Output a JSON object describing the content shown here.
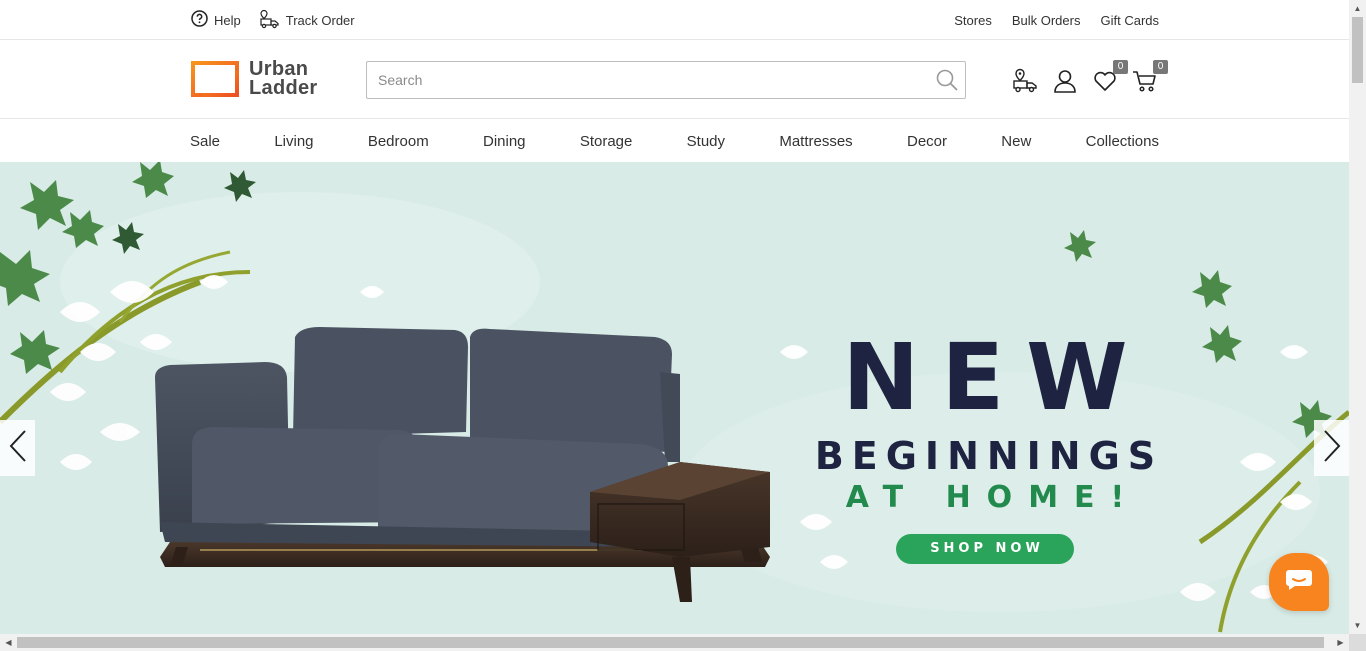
{
  "topbar": {
    "help_label": "Help",
    "track_order_label": "Track Order",
    "stores_label": "Stores",
    "bulk_orders_label": "Bulk Orders",
    "gift_cards_label": "Gift Cards"
  },
  "header": {
    "logo_line1": "Urban",
    "logo_line2": "Ladder",
    "search_placeholder": "Search",
    "wishlist_count": "0",
    "cart_count": "0"
  },
  "nav": {
    "items": [
      "Sale",
      "Living",
      "Bedroom",
      "Dining",
      "Storage",
      "Study",
      "Mattresses",
      "Decor",
      "New",
      "Collections"
    ]
  },
  "hero": {
    "headline": "NEW",
    "subheadline": "BEGINNINGS",
    "tagline": "AT HOME!",
    "cta_label": "SHOP NOW"
  },
  "colors": {
    "brand_orange": "#f26b21",
    "hero_bg": "#d7eae5",
    "headline_navy": "#1d2340",
    "tagline_green": "#238a4d",
    "cta_green": "#2aa45a",
    "chat_orange": "#f7841e"
  },
  "icons": {
    "help": "help-circle-icon",
    "track_order": "delivery-truck-icon",
    "search": "search-icon",
    "track": "truck-location-icon",
    "profile": "user-icon",
    "wishlist": "heart-icon",
    "cart": "cart-icon",
    "chat": "chat-bubble-icon"
  }
}
